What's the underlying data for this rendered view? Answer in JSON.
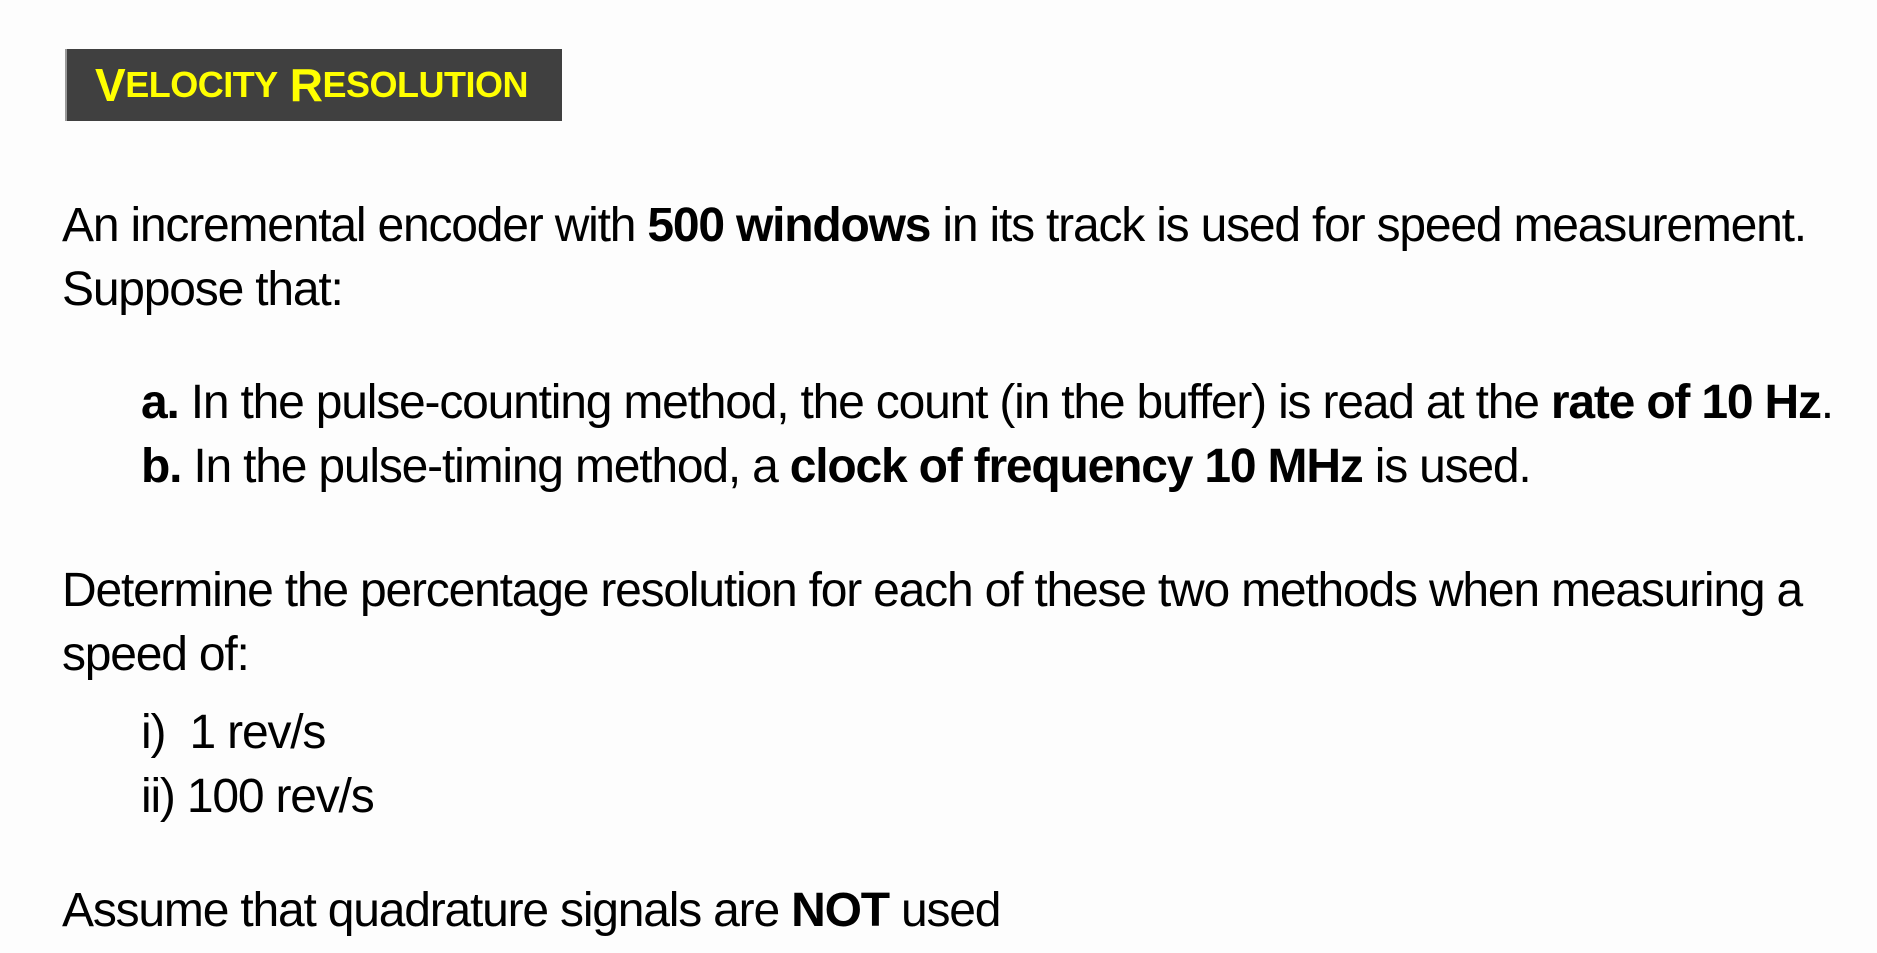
{
  "title": {
    "word1_initial": "V",
    "word1_rest": "ELOCITY",
    "word2_initial": "R",
    "word2_rest": "ESOLUTION"
  },
  "intro": {
    "line1_pre": "An incremental encoder with ",
    "line1_bold": "500 windows",
    "line1_post": " in its track is used for speed measurement.",
    "line2": "Suppose that:"
  },
  "conditions": [
    {
      "label": "a.",
      "pre": " In the pulse-counting method, the count (in the buffer) is read at the ",
      "bold": "rate of 10 Hz",
      "post": "."
    },
    {
      "label": "b.",
      "pre": " In the pulse-timing method, a ",
      "bold": "clock of frequency 10 MHz",
      "post": " is used."
    }
  ],
  "question": {
    "line1": "Determine the percentage resolution for each of these two methods when measuring a",
    "line2": "speed of:"
  },
  "speeds": [
    {
      "label": "i)",
      "value": "1 rev/s"
    },
    {
      "label": "ii)",
      "value": "100 rev/s"
    }
  ],
  "note": {
    "pre": "Assume that quadrature signals are ",
    "bold": "NOT",
    "post": " used"
  }
}
